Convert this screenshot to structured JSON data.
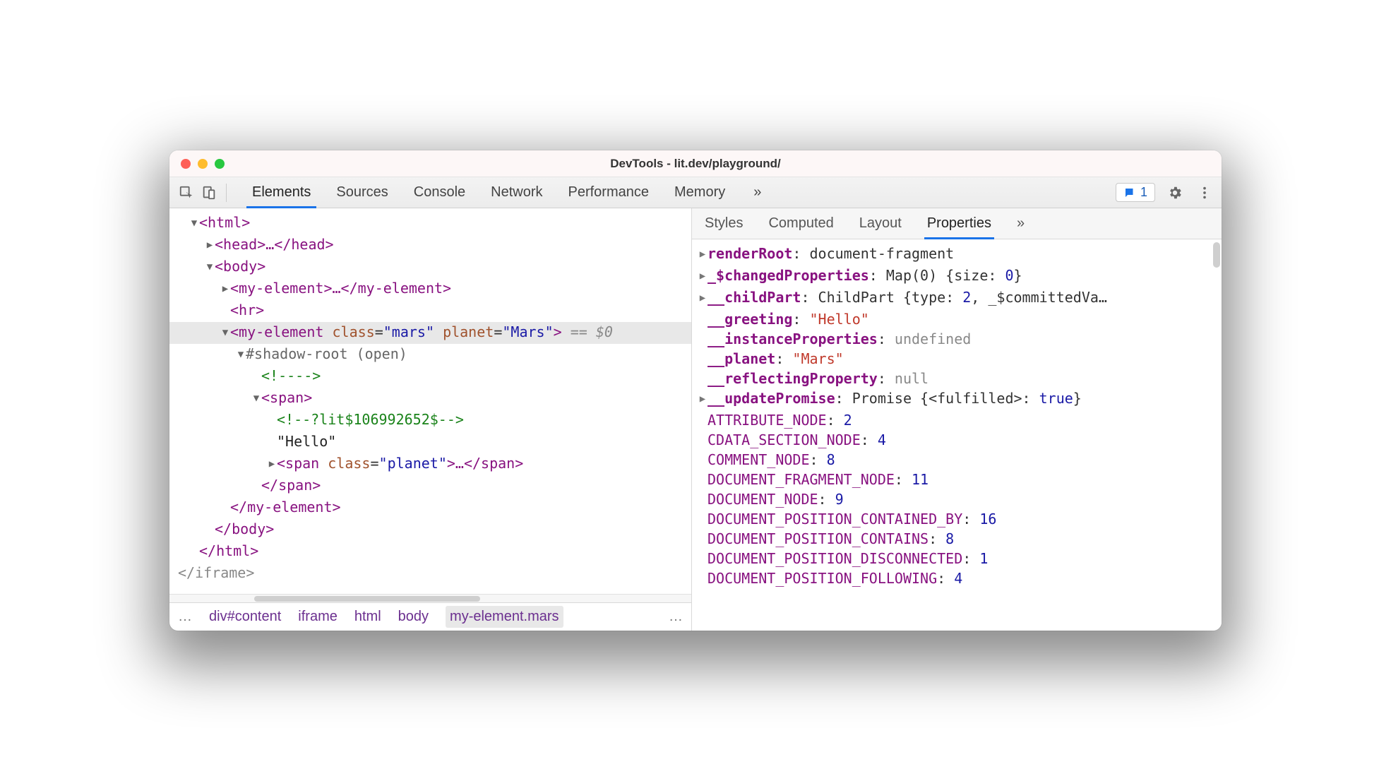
{
  "window": {
    "title": "DevTools - lit.dev/playground/"
  },
  "toolbar": {
    "tabs": [
      "Elements",
      "Sources",
      "Console",
      "Network",
      "Performance",
      "Memory"
    ],
    "active_tab": "Elements",
    "more": "»",
    "issues_count": "1"
  },
  "dom": {
    "open_html": "<html>",
    "head": "<head>…</head>",
    "open_body": "<body>",
    "my_el1": "<my-element>…</my-element>",
    "hr": "<hr>",
    "sel_open": "<my-element",
    "sel_class_name": "class",
    "sel_class_val": "\"mars\"",
    "sel_planet_name": "planet",
    "sel_planet_val": "\"Mars\"",
    "sel_close": ">",
    "sel_eq": " == $0",
    "shadow": "#shadow-root (open)",
    "cmt1": "<!---->",
    "open_span": "<span>",
    "cmt2": "<!--?lit$106992652$-->",
    "hello": "\"Hello\"",
    "span_planet_open": "<span",
    "span_planet_cls_name": "class",
    "span_planet_cls_val": "\"planet\"",
    "span_planet_mid": ">…</span>",
    "close_span": "</span>",
    "close_myel": "</my-element>",
    "close_body": "</body>",
    "close_html": "</html>",
    "iframe_ghost": "</iframe>"
  },
  "breadcrumb": {
    "ell_left": "…",
    "items": [
      "div#content",
      "iframe",
      "html",
      "body",
      "my-element.mars"
    ],
    "ell_right": "…"
  },
  "subtabs": {
    "items": [
      "Styles",
      "Computed",
      "Layout",
      "Properties"
    ],
    "active": "Properties",
    "more": "»"
  },
  "props": {
    "rows": [
      {
        "caret": "▶",
        "key": "renderRoot",
        "bold": true,
        "valtype": "obj",
        "val": "document-fragment"
      },
      {
        "caret": "▶",
        "key": "_$changedProperties",
        "bold": true,
        "valtype": "map",
        "val_prefix": "Map(0) {size: ",
        "val_num": "0",
        "val_suffix": "}"
      },
      {
        "caret": "▶",
        "key": "__childPart",
        "bold": true,
        "valtype": "child",
        "val_prefix": "ChildPart {type: ",
        "val_num": "2",
        "val_mid": ", _$committedVa…"
      },
      {
        "caret": "",
        "key": "__greeting",
        "bold": true,
        "valtype": "str",
        "val": "\"Hello\""
      },
      {
        "caret": "",
        "key": "__instanceProperties",
        "bold": true,
        "valtype": "gray",
        "val": "undefined"
      },
      {
        "caret": "",
        "key": "__planet",
        "bold": true,
        "valtype": "str",
        "val": "\"Mars\""
      },
      {
        "caret": "",
        "key": "__reflectingProperty",
        "bold": true,
        "valtype": "gray",
        "val": "null"
      },
      {
        "caret": "▶",
        "key": "__updatePromise",
        "bold": true,
        "valtype": "promise",
        "val_prefix": "Promise {<fulfilled>: ",
        "val_bool": "true",
        "val_suffix": "}"
      },
      {
        "caret": "",
        "key": "ATTRIBUTE_NODE",
        "bold": false,
        "valtype": "num",
        "val": "2"
      },
      {
        "caret": "",
        "key": "CDATA_SECTION_NODE",
        "bold": false,
        "valtype": "num",
        "val": "4"
      },
      {
        "caret": "",
        "key": "COMMENT_NODE",
        "bold": false,
        "valtype": "num",
        "val": "8"
      },
      {
        "caret": "",
        "key": "DOCUMENT_FRAGMENT_NODE",
        "bold": false,
        "valtype": "num",
        "val": "11"
      },
      {
        "caret": "",
        "key": "DOCUMENT_NODE",
        "bold": false,
        "valtype": "num",
        "val": "9"
      },
      {
        "caret": "",
        "key": "DOCUMENT_POSITION_CONTAINED_BY",
        "bold": false,
        "valtype": "num",
        "val": "16"
      },
      {
        "caret": "",
        "key": "DOCUMENT_POSITION_CONTAINS",
        "bold": false,
        "valtype": "num",
        "val": "8"
      },
      {
        "caret": "",
        "key": "DOCUMENT_POSITION_DISCONNECTED",
        "bold": false,
        "valtype": "num",
        "val": "1"
      },
      {
        "caret": "",
        "key": "DOCUMENT_POSITION_FOLLOWING",
        "bold": false,
        "valtype": "num",
        "val": "4"
      }
    ]
  }
}
